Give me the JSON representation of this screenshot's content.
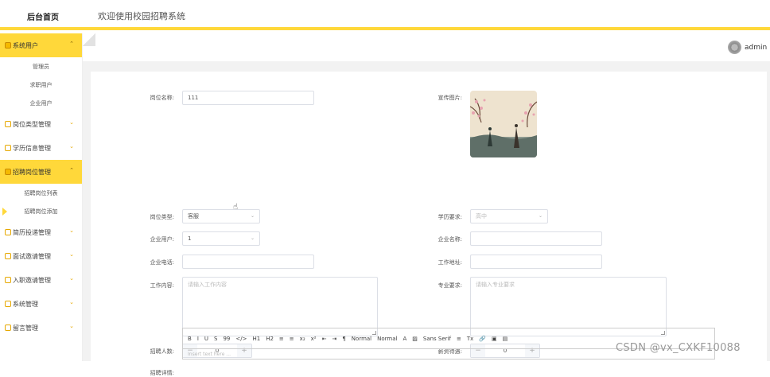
{
  "header": {
    "brand": "后台首页",
    "welcome": "欢迎使用校园招聘系统"
  },
  "user": {
    "name": "admin"
  },
  "sidebar": {
    "groups": [
      {
        "label": "系统用户",
        "active": true,
        "subs": [
          "管理员",
          "求职用户",
          "企业用户"
        ]
      },
      {
        "label": "岗位类型管理",
        "active": false
      },
      {
        "label": "学历信息管理",
        "active": false
      },
      {
        "label": "招聘岗位管理",
        "active": true,
        "subs": [
          "招聘岗位列表",
          "招聘岗位添加"
        ]
      },
      {
        "label": "简历投递管理",
        "active": false
      },
      {
        "label": "面试邀请管理",
        "active": false
      },
      {
        "label": "入职邀请管理",
        "active": false
      },
      {
        "label": "系统管理",
        "active": false
      },
      {
        "label": "留言管理",
        "active": false
      }
    ]
  },
  "form": {
    "position_name": {
      "label": "岗位名称:",
      "value": "111"
    },
    "promo_image": {
      "label": "宣传图片:"
    },
    "position_type": {
      "label": "岗位类型:",
      "value": "客服"
    },
    "education": {
      "label": "学历要求:",
      "placeholder": "高中"
    },
    "company_user": {
      "label": "企业用户:",
      "value": "1"
    },
    "company_name": {
      "label": "企业名称:",
      "value": ""
    },
    "company_phone": {
      "label": "企业电话:",
      "value": ""
    },
    "work_address": {
      "label": "工作地址:",
      "value": ""
    },
    "job_content": {
      "label": "工作内容:",
      "placeholder": "请输入工作内容"
    },
    "major_req": {
      "label": "专业要求:",
      "placeholder": "请输入专业要求"
    },
    "headcount": {
      "label": "招聘人数:",
      "value": "0",
      "minus": "−",
      "plus": "+"
    },
    "salary": {
      "label": "薪资待遇:",
      "value": "0",
      "minus": "−",
      "plus": "+"
    },
    "details": {
      "label": "招聘详情:",
      "editor_placeholder": "Insert text here ..."
    }
  },
  "toolbar": {
    "items": [
      "B",
      "I",
      "U",
      "S",
      "99",
      "</>",
      "H1",
      "H2",
      "≡",
      "≡",
      "x₂",
      "x²",
      "⇤",
      "⇥",
      "¶",
      "Normal",
      "Normal",
      "A",
      "▨",
      "Sans Serif",
      "≡",
      "Tx",
      "🔗",
      "▣",
      "▤"
    ]
  },
  "watermark": "CSDN @vx_CXKF10088",
  "colors": {
    "accent": "#ffd83a",
    "icon": "#e6a800"
  }
}
